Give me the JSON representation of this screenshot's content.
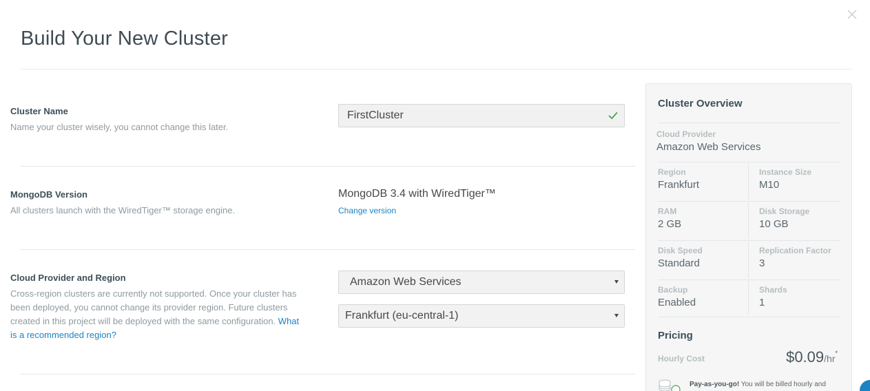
{
  "modal": {
    "title": "Build Your New Cluster",
    "close_icon": "close-icon"
  },
  "cluster_name": {
    "label": "Cluster Name",
    "description": "Name your cluster wisely, you cannot change this later.",
    "value": "FirstCluster",
    "valid_icon": "checkmark-icon",
    "valid_color": "#4ba34a"
  },
  "mongodb_version": {
    "label": "MongoDB Version",
    "description": "All clusters launch with the WiredTiger™ storage engine.",
    "value": "MongoDB 3.4 with WiredTiger™",
    "change_link": "Change version"
  },
  "cloud_provider": {
    "label": "Cloud Provider and Region",
    "description": "Cross-region clusters are currently not supported. Once your cluster has been deployed, you cannot change its provider region. Future clusters created in this project will be deployed with the same configuration.",
    "help_link": "What is a recommended region?",
    "provider_selected": "Amazon Web Services",
    "region_selected": "Frankfurt (eu-central-1)"
  },
  "overview": {
    "title": "Cluster Overview",
    "cloud_provider_label": "Cloud Provider",
    "cloud_provider_value": "Amazon Web Services",
    "region_label": "Region",
    "region_value": "Frankfurt",
    "instance_size_label": "Instance Size",
    "instance_size_value": "M10",
    "ram_label": "RAM",
    "ram_value": "2 GB",
    "disk_storage_label": "Disk Storage",
    "disk_storage_value": "10 GB",
    "disk_speed_label": "Disk Speed",
    "disk_speed_value": "Standard",
    "replication_factor_label": "Replication Factor",
    "replication_factor_value": "3",
    "backup_label": "Backup",
    "backup_value": "Enabled",
    "shards_label": "Shards",
    "shards_value": "1"
  },
  "pricing": {
    "title": "Pricing",
    "hourly_cost_label": "Hourly Cost",
    "hourly_cost_value": "$0.09",
    "hourly_cost_unit": "/hr",
    "hourly_cost_footnote": "*",
    "payg_icon": "coins-icon",
    "payg_bold": "Pay-as-you-go!",
    "payg_text": " You will be billed hourly and"
  },
  "colors": {
    "link": "#1a83c5",
    "panel_bg": "#f6f6f6",
    "check": "#4ba34a"
  }
}
